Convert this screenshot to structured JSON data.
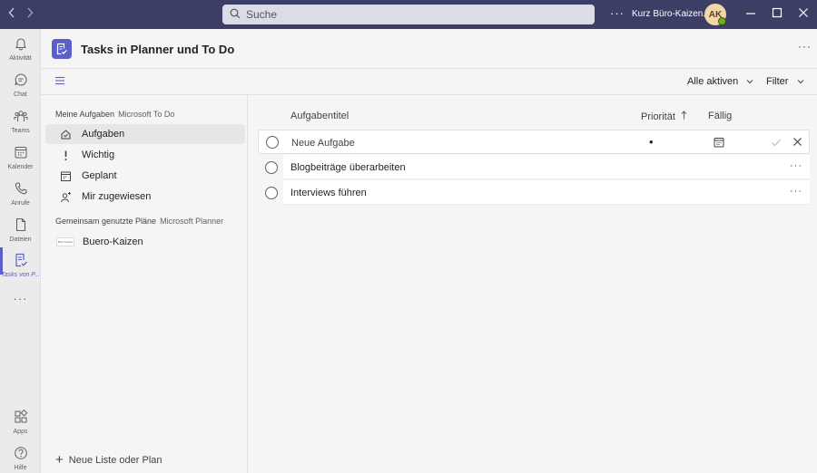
{
  "titlebar": {
    "back_icon": "chevron-left-icon",
    "forward_icon": "chevron-right-icon",
    "search_placeholder": "Suche",
    "more": "···",
    "org_name": "Kurz Büro-Kaizen...",
    "avatar_initials": "AK",
    "presence_color": "#6bb700",
    "bar_color": "#3d3e66"
  },
  "rail": {
    "items": [
      {
        "label": "Aktivität",
        "icon": "bell-icon"
      },
      {
        "label": "Chat",
        "icon": "chat-icon"
      },
      {
        "label": "Teams",
        "icon": "teams-icon"
      },
      {
        "label": "Kalender",
        "icon": "calendar-icon"
      },
      {
        "label": "Anrufe",
        "icon": "phone-icon"
      },
      {
        "label": "Dateien",
        "icon": "file-icon"
      },
      {
        "label": "Tasks von P...",
        "icon": "tasks-icon",
        "active": true
      }
    ],
    "more": "···",
    "bottom": [
      {
        "label": "Apps",
        "icon": "apps-icon"
      },
      {
        "label": "Hilfe",
        "icon": "help-icon"
      }
    ],
    "accent": "#5b5fc7"
  },
  "header": {
    "title": "Tasks in Planner und To Do",
    "more": "···"
  },
  "toolbar": {
    "view_label": "Alle aktiven",
    "filter_label": "Filter"
  },
  "sidebar": {
    "my_tasks_heading": "Meine Aufgaben",
    "my_tasks_source": "Microsoft To Do",
    "my_items": [
      {
        "label": "Aufgaben",
        "icon": "home-icon",
        "selected": true
      },
      {
        "label": "Wichtig",
        "icon": "exclamation-icon"
      },
      {
        "label": "Geplant",
        "icon": "calendar-grid-icon"
      },
      {
        "label": "Mir zugewiesen",
        "icon": "person-add-icon"
      }
    ],
    "shared_heading": "Gemeinsam genutzte Pläne",
    "shared_source": "Microsoft Planner",
    "plans": [
      {
        "label": "Buero-Kaizen",
        "thumb_text": "Büro-Kaizen"
      }
    ],
    "new_list_label": "Neue Liste oder Plan"
  },
  "main": {
    "columns": {
      "title": "Aufgabentitel",
      "priority": "Priorität",
      "due": "Fällig"
    },
    "new_task": {
      "placeholder": "Neue Aufgabe",
      "priority": "•"
    },
    "tasks": [
      {
        "title": "Blogbeiträge überarbeiten",
        "more": "···"
      },
      {
        "title": "Interviews führen",
        "more": "···"
      }
    ]
  }
}
